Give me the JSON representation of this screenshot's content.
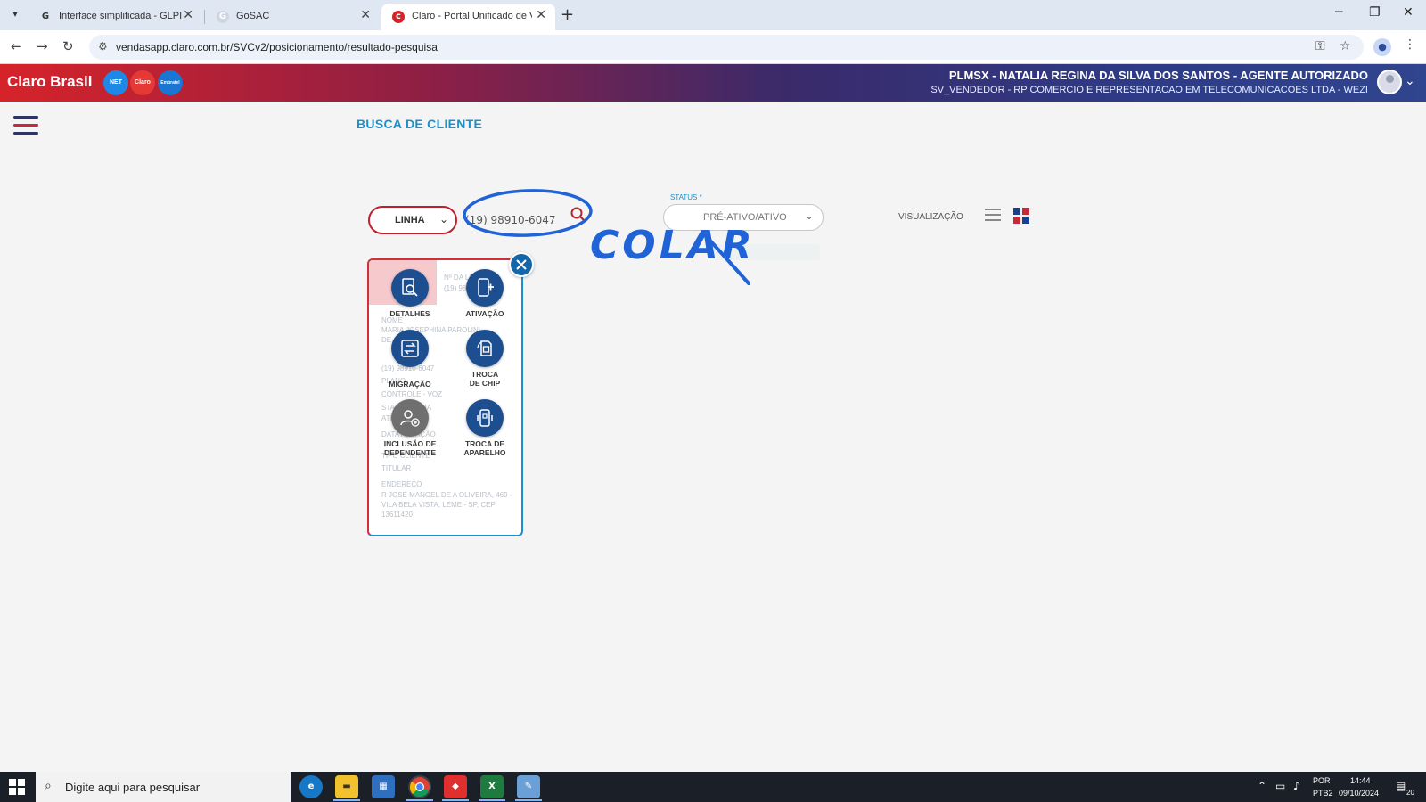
{
  "browser": {
    "tabs": [
      {
        "label": "Interface simplificada - GLPI",
        "icon": "glpi-icon",
        "close": "✕"
      },
      {
        "label": "GoSAC",
        "icon": "gosac-icon",
        "close": "✕"
      },
      {
        "label": "Claro - Portal Unificado de Vend",
        "icon": "claro-icon",
        "close": "✕"
      }
    ],
    "url": "vendasapp.claro.com.br/SVCv2/posicionamento/resultado-pesquisa"
  },
  "header": {
    "brand": "Claro Brasil",
    "badges": [
      {
        "label": "NET",
        "color": "#1e88e5"
      },
      {
        "label": "Claro",
        "color": "#e53935"
      },
      {
        "label": "Embratel",
        "color": "#1976d2"
      }
    ],
    "user_name": "PLMSX - NATALIA REGINA DA SILVA DOS SANTOS - AGENTE AUTORIZADO",
    "user_company": "SV_VENDEDOR - RP COMERCIO E REPRESENTACAO EM TELECOMUNICACOES LTDA - WEZI"
  },
  "page": {
    "title": "BUSCA DE CLIENTE"
  },
  "search": {
    "type_label": "LINHA",
    "value": "(19) 98910-6047",
    "status_label": "STATUS *",
    "status_value": "PRÉ-ATIVO/ATIVO",
    "view_label": "VISUALIZAÇÃO"
  },
  "annotation": {
    "text": "COLAR",
    "color": "#1f63d6"
  },
  "card": {
    "faint_header": "Nº DA LINHA",
    "faint_number": "(19) 98910-6047",
    "faint_lines": [
      "NOME",
      "MARIA JOSEPHINA PAROLINI",
      "DE",
      "(19) 98910-6047",
      "PLANO",
      "CONTROLE - VOZ",
      "STATUS LINHA",
      "ATIVO",
      "DATA ATIVAÇÃO",
      "TIPO CLIENTE",
      "TITULAR",
      "ENDEREÇO",
      "R JOSE MANOEL DE A OLIVEIRA, 469 -",
      "VILA BELA VISTA, LEME - SP, CEP",
      "13611420"
    ],
    "actions": [
      {
        "label": "DETALHES",
        "icon": "document-search-icon"
      },
      {
        "label": "ATIVAÇÃO",
        "icon": "phone-plus-icon"
      },
      {
        "label": "MIGRAÇÃO",
        "icon": "migration-arrows-icon"
      },
      {
        "label": "TROCA\nDE CHIP",
        "icon": "sim-swap-icon"
      },
      {
        "label": "INCLUSÃO DE\nDEPENDENTE",
        "icon": "add-user-icon"
      },
      {
        "label": "TROCA DE\nAPARELHO",
        "icon": "device-swap-icon"
      }
    ]
  },
  "taskbar": {
    "search_placeholder": "Digite aqui para pesquisar",
    "lang_top": "POR",
    "lang_bottom": "PTB2",
    "time": "14:44",
    "date": "09/10/2024",
    "notifications": "20"
  },
  "colors": {
    "accent_blue": "#1c91c9",
    "claro_red": "#d6232a",
    "action_blue": "#1d4f90"
  }
}
